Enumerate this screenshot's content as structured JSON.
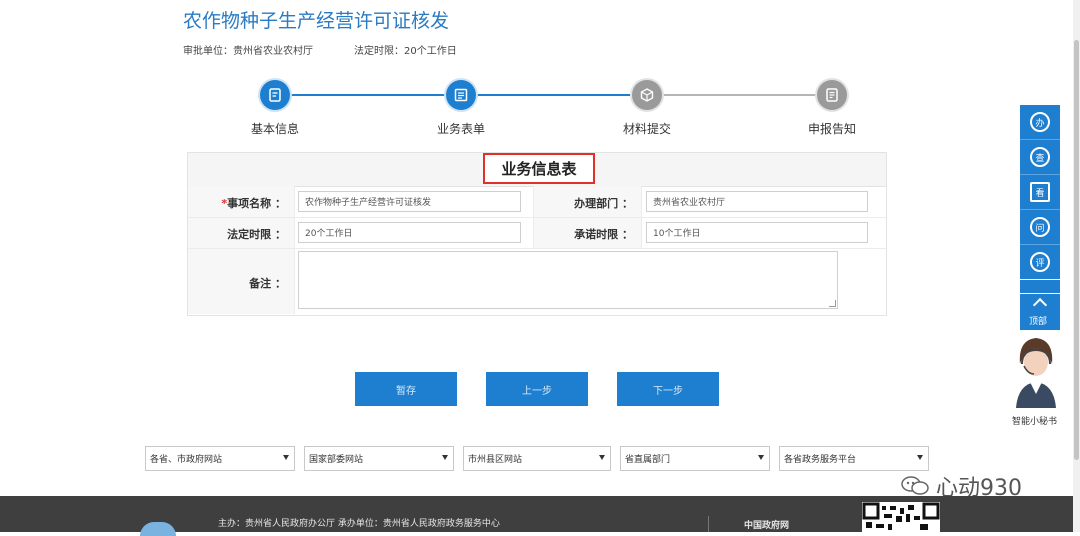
{
  "header": {
    "title": "农作物种子生产经营许可证核发",
    "approval_unit": "审批单位：贵州省农业农村厅",
    "time_limit": "法定时限：20个工作日"
  },
  "steps": [
    {
      "label": "基本信息",
      "state": "active",
      "icon": "document-icon"
    },
    {
      "label": "业务表单",
      "state": "active",
      "icon": "form-icon"
    },
    {
      "label": "材料提交",
      "state": "inactive",
      "icon": "box-icon"
    },
    {
      "label": "申报告知",
      "state": "inactive",
      "icon": "notice-icon"
    }
  ],
  "form": {
    "title": "业务信息表",
    "item_name_required": "*",
    "item_name_label": "事项名称 ：",
    "item_name_value": "农作物种子生产经营许可证核发",
    "dept_label": "办理部门 ：",
    "dept_value": "贵州省农业农村厅",
    "legal_limit_label": "法定时限 ：",
    "legal_limit_value": "20个工作日",
    "promise_limit_label": "承诺时限 ：",
    "promise_limit_value": "10个工作日",
    "remark_label": "备注 ：",
    "remark_value": ""
  },
  "buttons": {
    "save": "暂存",
    "prev": "上一步",
    "next": "下一步"
  },
  "selects": [
    "各省、市政府网站",
    "国家部委网站",
    "市州县区网站",
    "省直属部门",
    "各省政务服务平台"
  ],
  "footer": {
    "host": "主办：贵州省人民政府办公厅  承办单位：贵州省人民政府政务服务中心",
    "gov_link": "中国政府网"
  },
  "side_toolbar": {
    "items": [
      {
        "icon": "handle-icon",
        "text": "办"
      },
      {
        "icon": "query-icon",
        "text": "查"
      },
      {
        "icon": "view-icon",
        "text": "看"
      },
      {
        "icon": "ask-icon",
        "text": "问"
      },
      {
        "icon": "rate-icon",
        "text": "评"
      }
    ],
    "top_label": "顶部",
    "assistant_label": "智能小秘书"
  },
  "watermark": "心动930",
  "colors": {
    "primary": "#1e7fd0",
    "title": "#2a7bc4",
    "highlight_border": "#e0302a",
    "footer_bg": "#3f3f3f"
  }
}
